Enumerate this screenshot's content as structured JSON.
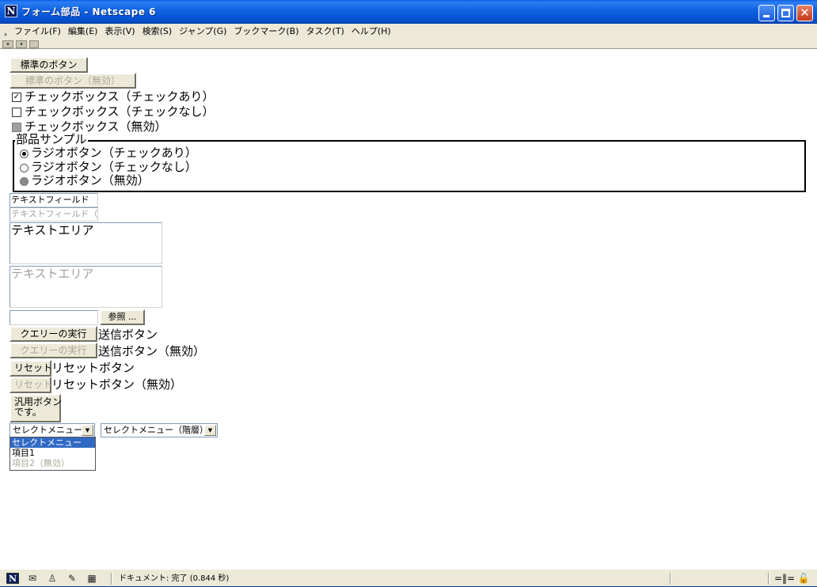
{
  "window": {
    "title": "フォーム部品 - Netscape 6",
    "logo": "N",
    "close_glyph": "✕"
  },
  "menubar": {
    "items": [
      {
        "label": "ファイル(F)"
      },
      {
        "label": "編集(E)"
      },
      {
        "label": "表示(V)"
      },
      {
        "label": "検索(S)"
      },
      {
        "label": "ジャンプ(G)"
      },
      {
        "label": "ブックマーク(B)"
      },
      {
        "label": "タスク(T)"
      },
      {
        "label": "ヘルプ(H)"
      }
    ]
  },
  "form": {
    "button_standard": "標準のボタン",
    "button_standard_disabled": "標準のボタン（無効）",
    "checkbox_checked": {
      "label": "チェックボックス（チェックあり）",
      "mark": "✓"
    },
    "checkbox_unchecked": {
      "label": "チェックボックス（チェックなし）"
    },
    "checkbox_disabled": {
      "label": "チェックボックス（無効）"
    },
    "fieldset_legend": "部品サンプル",
    "radio_checked": "ラジオボタン（チェックあり）",
    "radio_unchecked": "ラジオボタン（チェックなし）",
    "radio_disabled": "ラジオボタン（無効）",
    "text_field": "テキストフィールド",
    "text_field_disabled": "テキストフィールド（無効）",
    "textarea": "テキストエリア",
    "textarea_disabled": "テキストエリア",
    "file_browse_button": "参照 ...",
    "submit_button": "クエリーの実行",
    "submit_label": "送信ボタン",
    "submit_button_disabled": "クエリーの実行",
    "submit_label_disabled": "送信ボタン（無効）",
    "reset_button": "リセット",
    "reset_label": "リセットボタン",
    "reset_button_disabled": "リセット",
    "reset_label_disabled": "リセットボタン（無効）",
    "generic_button_line1": "汎用ボタン",
    "generic_button_line2": "です。",
    "select_menu": {
      "selected": "セレクトメニュー",
      "options": [
        {
          "label": "セレクトメニュー",
          "state": "selected"
        },
        {
          "label": "項目1",
          "state": "normal"
        },
        {
          "label": "項目2（無効）",
          "state": "disabled"
        }
      ],
      "arrow": "▼"
    },
    "select_menu_hier": {
      "selected": "セレクトメニュー（階層）",
      "arrow": "▼"
    }
  },
  "statusbar": {
    "text": "ドキュメント: 完了 (0.844 秒)",
    "icons": [
      "netscape-logo",
      "mail",
      "person",
      "composer",
      "ime"
    ],
    "right_glyph": "=‖= 🔓"
  },
  "colors": {
    "titlebar": "#0653d4",
    "face": "#ece9d8",
    "selection": "#316ac5",
    "disabled_text": "#aca899"
  }
}
